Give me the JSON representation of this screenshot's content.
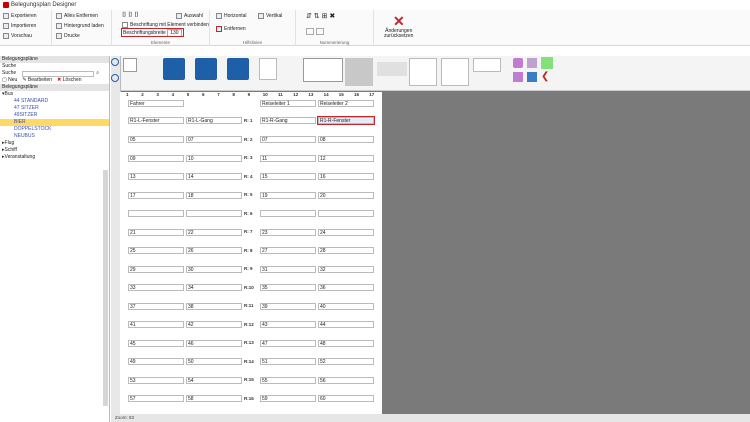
{
  "window": {
    "title": "Belegungsplan Designer"
  },
  "ribbon": {
    "export": "Exportieren",
    "import": "Importieren",
    "preview": "Vorschau",
    "remove_all": "Alles Entfernen",
    "background": "Hintergrund laden",
    "print": "Drucke",
    "select": "Auswahl",
    "label_assign": "Beschriftung mit Element verbinden",
    "label_width": "Beschriftungsbreite",
    "label_width_val": "130",
    "group_elements": "Elemente",
    "horizontal": "Horizontal",
    "vertical": "Vertikal",
    "remove": "Entfernen",
    "group_helplines": "Hilfslinien",
    "group_numbering": "Nummerierung",
    "discard": "Änderungen\nzurücksetzen"
  },
  "left": {
    "header": "Belegungspläne",
    "search_label": "Suche",
    "search2_label": "Suche",
    "btn_new": "Neu",
    "btn_edit": "Bearbeiten",
    "btn_delete": "Löschen",
    "tree_header": "Belegungspläne",
    "bus": "Bus",
    "bus_items": [
      "44 STANDARD",
      "47 SITZER",
      "49SITZER",
      "BIER",
      "DOPPELSTOCK",
      "NEUBUS"
    ],
    "flug": "Flug",
    "schiff": "Schiff",
    "veranstaltung": "Veranstaltung"
  },
  "grid": {
    "columns": [
      "1",
      "2",
      "3",
      "4",
      "5",
      "6",
      "7",
      "8",
      "9",
      "10",
      "11",
      "12",
      "13",
      "14",
      "15",
      "16",
      "17"
    ],
    "headers": [
      "Fahrer",
      "Reiseleiter 1",
      "Reiseleiter 2"
    ],
    "row1": [
      "R1-L-Fenster",
      "R1-L-Gang",
      "R1-R-Gang",
      "R1-R-Fenster"
    ],
    "seats": [
      [
        "05",
        "07",
        "07",
        "08"
      ],
      [
        "09",
        "10",
        "11",
        "12"
      ],
      [
        "13",
        "14",
        "15",
        "16"
      ],
      [
        "17",
        "18",
        "19",
        "20"
      ],
      [
        "",
        "",
        "",
        ""
      ],
      [
        "21",
        "22",
        "23",
        "24"
      ],
      [
        "25",
        "26",
        "27",
        "28"
      ],
      [
        "29",
        "30",
        "31",
        "32"
      ],
      [
        "33",
        "34",
        "35",
        "36"
      ],
      [
        "37",
        "38",
        "39",
        "40"
      ],
      [
        "41",
        "42",
        "43",
        "44"
      ],
      [
        "45",
        "46",
        "47",
        "48"
      ],
      [
        "49",
        "50",
        "51",
        "52"
      ],
      [
        "53",
        "54",
        "55",
        "56"
      ],
      [
        "57",
        "58",
        "59",
        "60"
      ]
    ],
    "rowlabels": [
      "R: 1",
      "R: 2",
      "R: 3",
      "R: 4",
      "R: 5",
      "R: 6",
      "R: 7",
      "R: 8",
      "R: 9",
      "R:10",
      "R:11",
      "R:12",
      "R:13",
      "R:14",
      "R:15",
      "R:16"
    ]
  },
  "status": "Zoom: 83"
}
